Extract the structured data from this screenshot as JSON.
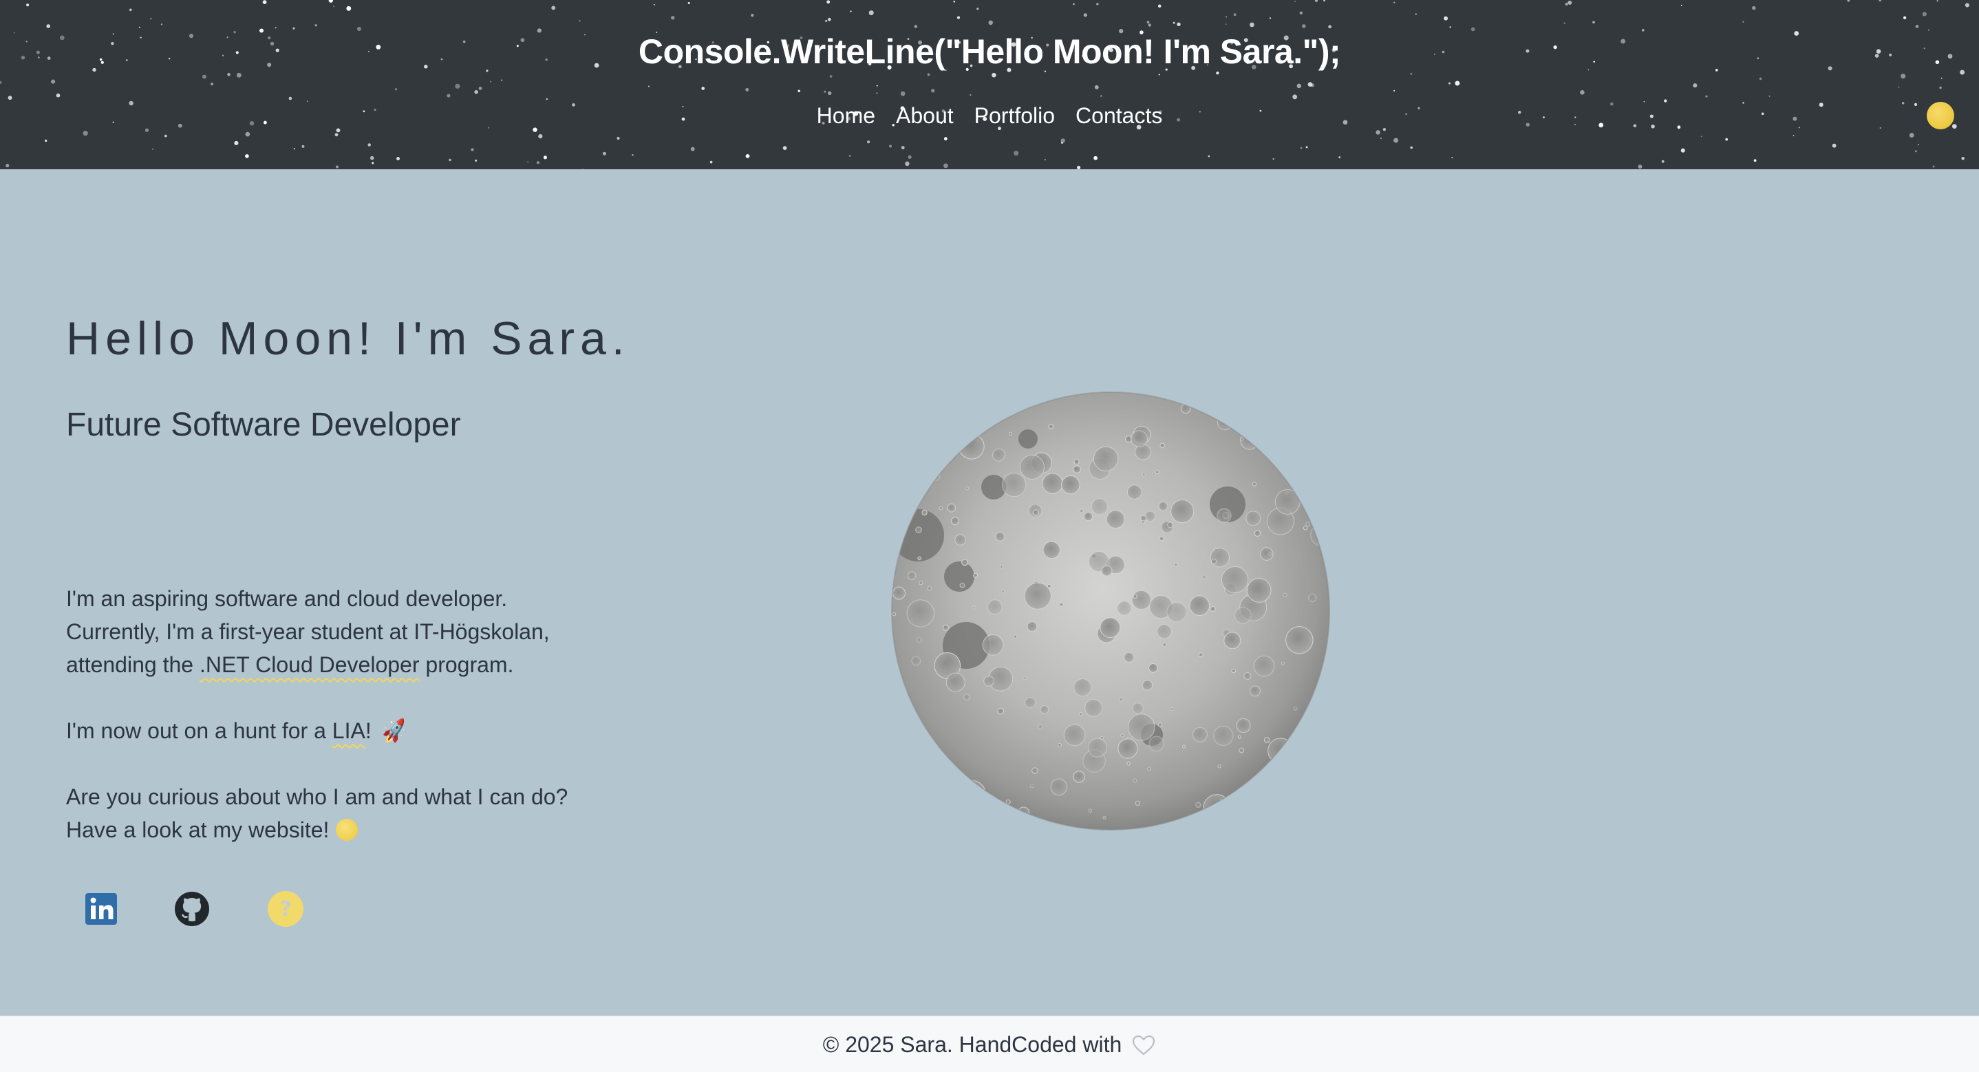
{
  "header": {
    "title": "Console.WriteLine(\"Hello Moon! I'm Sara.\");",
    "nav": [
      {
        "label": "Home"
      },
      {
        "label": "About"
      },
      {
        "label": "Portfolio"
      },
      {
        "label": "Contacts"
      }
    ],
    "theme_toggle_icon": "moon-toggle-icon"
  },
  "hero": {
    "heading": "Hello Moon! I'm Sara.",
    "subheading": "Future Software Developer",
    "intro_line_1": "I'm an aspiring software and cloud developer.",
    "intro_line_2": "Currently, I'm a first-year student at IT-Högskolan,",
    "intro_line_3_before": "attending the ",
    "intro_highlight": ".NET Cloud Developer",
    "intro_line_3_after": " program.",
    "lia_before": "I'm now out on a hunt for a ",
    "lia_highlight": "LIA",
    "lia_after": "!",
    "lia_emoji": "🚀",
    "curious_line_1": "Are you curious about who I am and what I can do?",
    "curious_line_2": "Have a look at my website!",
    "socials": [
      {
        "icon": "linkedin-icon",
        "color": "#2f6ea8"
      },
      {
        "icon": "github-icon",
        "color": "#22272c"
      },
      {
        "icon": "question-icon",
        "color": "#f2da6a"
      }
    ]
  },
  "moon_image": "moon-illustration",
  "footer": {
    "text": "© 2025 Sara. HandCoded with",
    "icon": "heart-icon"
  },
  "colors": {
    "header_bg": "#33383d",
    "main_bg": "#b3c5cf",
    "text": "#2c3540",
    "accent": "#f3d65a",
    "footer_bg": "#f7f8fa"
  }
}
